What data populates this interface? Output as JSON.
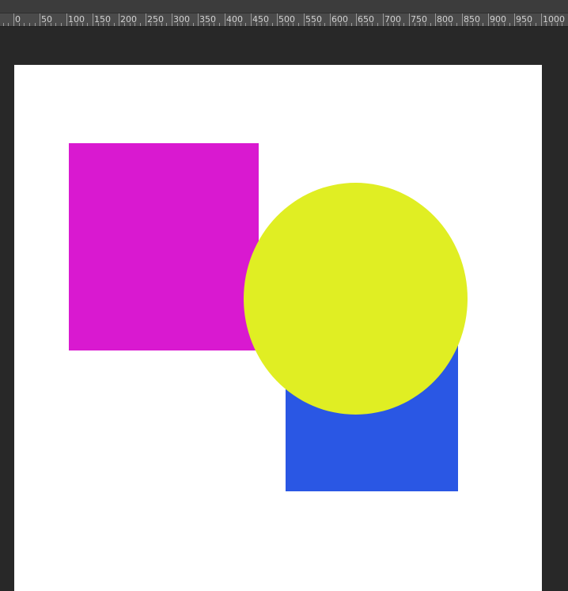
{
  "ruler": {
    "labels": [
      "0",
      "50",
      "100",
      "150",
      "200",
      "250",
      "300",
      "350",
      "400",
      "450",
      "500",
      "550",
      "600",
      "650",
      "700",
      "750",
      "800",
      "850",
      "900",
      "950",
      "1000"
    ]
  },
  "document": {
    "background_color": "#ffffff",
    "shapes": [
      {
        "name": "magenta-rectangle",
        "type": "rectangle",
        "color": "#d919d0"
      },
      {
        "name": "blue-rectangle",
        "type": "rectangle",
        "color": "#2a57e4"
      },
      {
        "name": "yellow-circle",
        "type": "ellipse",
        "color": "#e0ee23"
      }
    ]
  },
  "workspace": {
    "background_color": "#282828",
    "ruler_color": "#4a4a4a"
  }
}
